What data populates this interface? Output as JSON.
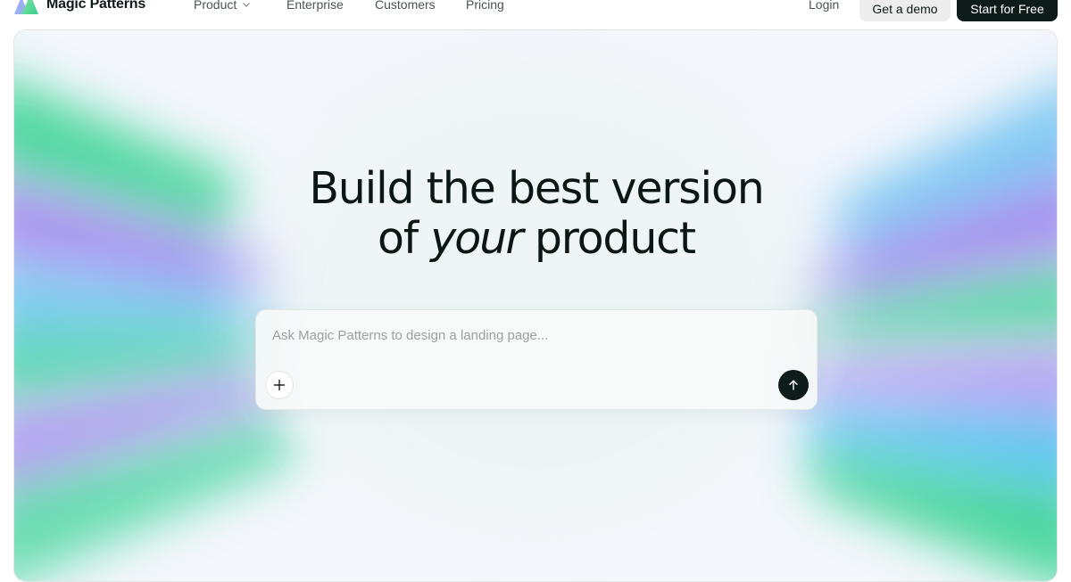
{
  "brand": {
    "name": "Magic Patterns",
    "logo_icon": "magic-patterns-logo-icon"
  },
  "nav": {
    "links": [
      {
        "label": "Product",
        "has_dropdown": true
      },
      {
        "label": "Enterprise",
        "has_dropdown": false
      },
      {
        "label": "Customers",
        "has_dropdown": false
      },
      {
        "label": "Pricing",
        "has_dropdown": false
      }
    ],
    "login_label": "Login",
    "demo_label": "Get a demo",
    "start_label": "Start for Free"
  },
  "hero": {
    "headline_line1": "Build the best version",
    "headline_line2_pre": "of",
    "headline_line2_em": "your",
    "headline_line2_post": "product"
  },
  "prompt": {
    "placeholder": "Ask Magic Patterns to design a landing page...",
    "value": "",
    "attach_icon": "plus-icon",
    "send_icon": "arrow-up-icon"
  },
  "colors": {
    "primary_dark": "#0d1c1b",
    "text": "#0b1716",
    "nav_text": "#4a5452",
    "demo_bg": "#ededed",
    "gradient_green": "#3fd49a",
    "gradient_purple": "#a98ef0",
    "gradient_blue": "#6fb4f2"
  }
}
